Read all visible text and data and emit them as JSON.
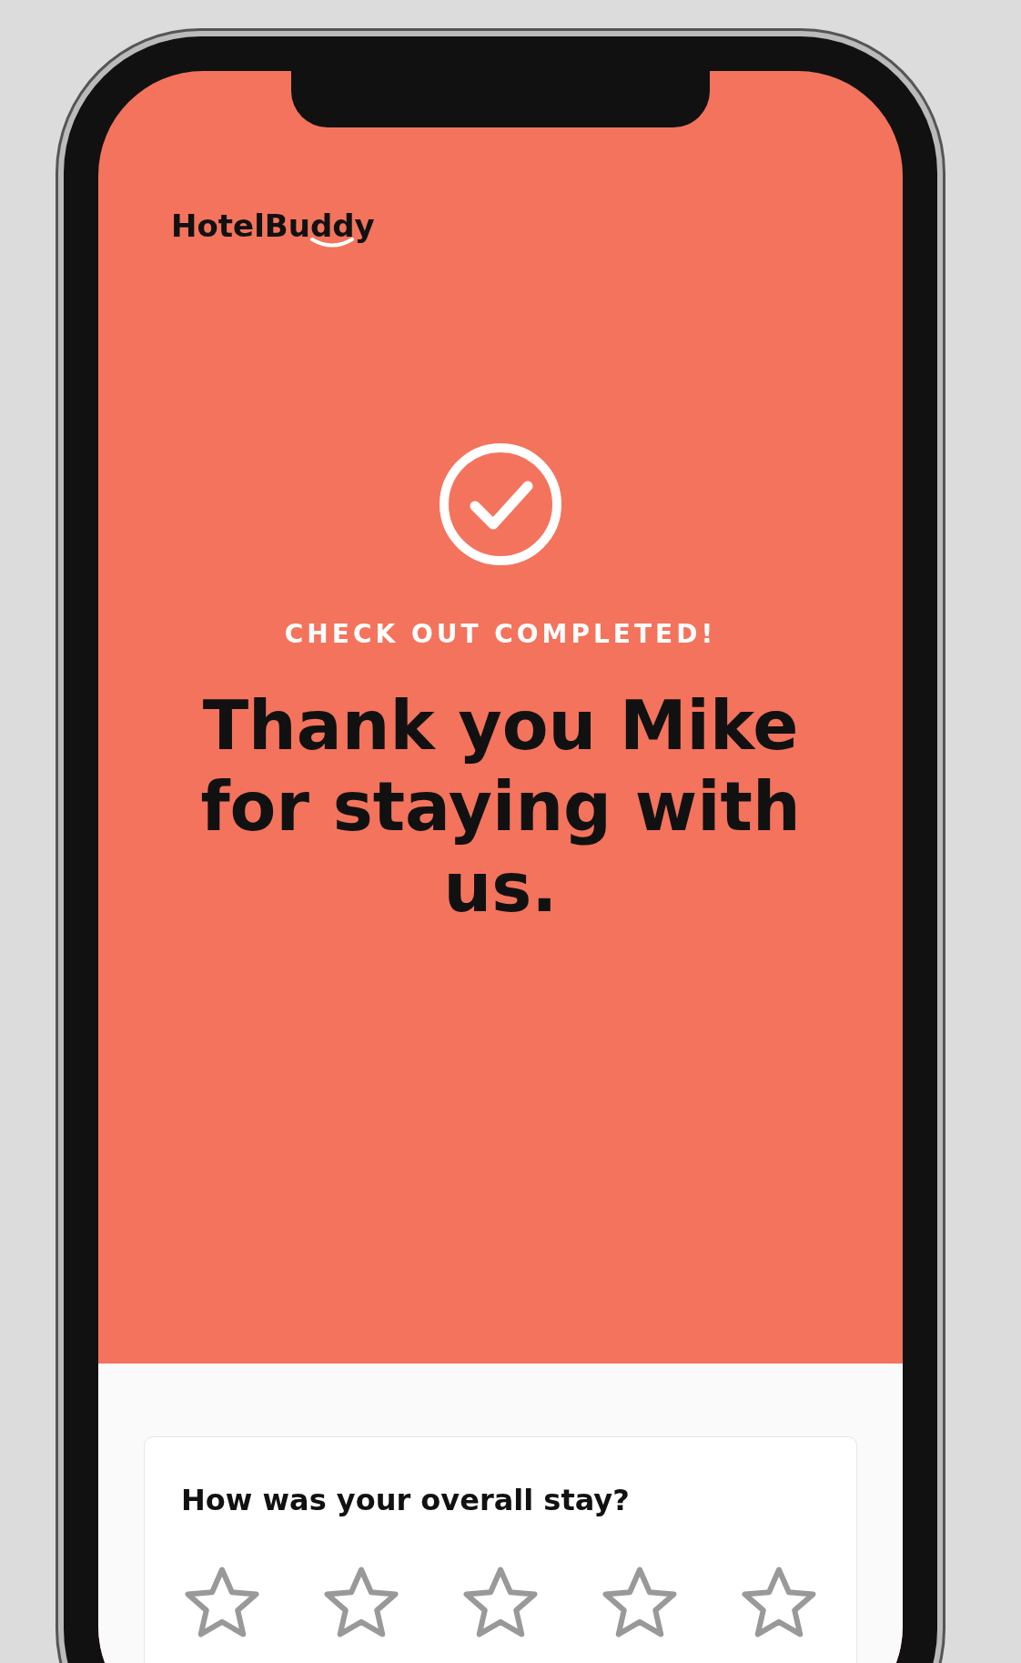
{
  "brand": {
    "name": "HotelBuddy"
  },
  "status": {
    "label": "CHECK OUT COMPLETED!"
  },
  "heading": "Thank you Mike for staying with us.",
  "rating": {
    "question": "How was your overall stay?",
    "stars": 0
  }
}
